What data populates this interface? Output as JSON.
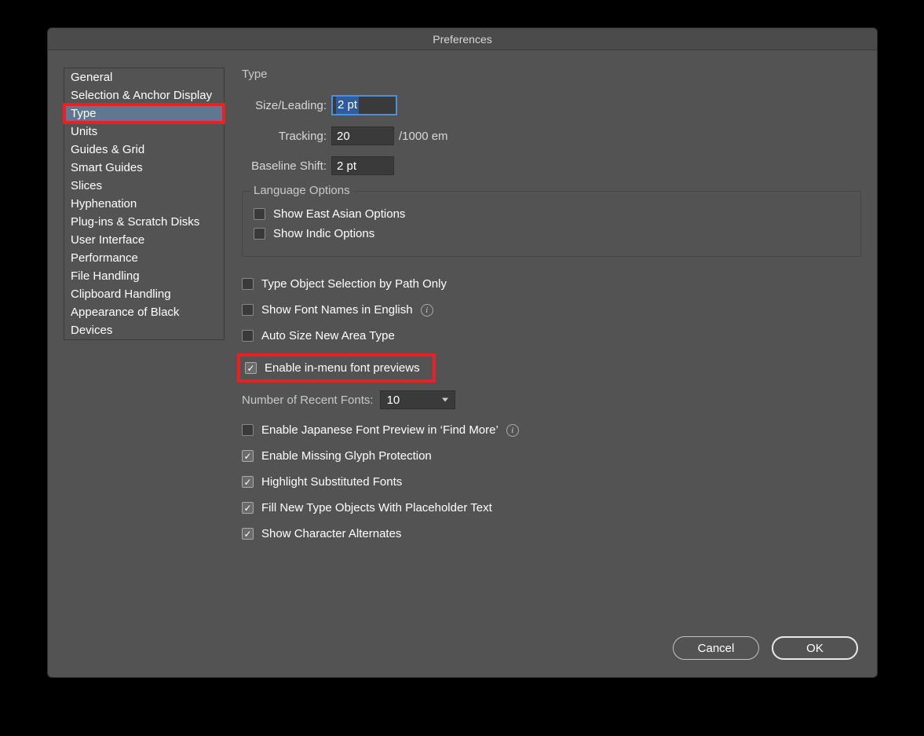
{
  "title": "Preferences",
  "sidebar": {
    "items": [
      "General",
      "Selection & Anchor Display",
      "Type",
      "Units",
      "Guides & Grid",
      "Smart Guides",
      "Slices",
      "Hyphenation",
      "Plug-ins & Scratch Disks",
      "User Interface",
      "Performance",
      "File Handling",
      "Clipboard Handling",
      "Appearance of Black",
      "Devices"
    ],
    "selectedIndex": 2
  },
  "panel": {
    "heading": "Type",
    "sizeLeading": {
      "label": "Size/Leading:",
      "value": "2 pt"
    },
    "tracking": {
      "label": "Tracking:",
      "value": "20",
      "unit": "/1000 em"
    },
    "baselineShift": {
      "label": "Baseline Shift:",
      "value": "2 pt"
    },
    "languageOptions": {
      "legend": "Language Options",
      "eastAsian": {
        "label": "Show East Asian Options",
        "checked": false
      },
      "indic": {
        "label": "Show Indic Options",
        "checked": false
      }
    },
    "typeObjectPath": {
      "label": "Type Object Selection by Path Only",
      "checked": false
    },
    "fontNamesEnglish": {
      "label": "Show Font Names in English",
      "checked": false
    },
    "autoSize": {
      "label": "Auto Size New Area Type",
      "checked": false
    },
    "inMenuPreview": {
      "label": "Enable in-menu font previews",
      "checked": true
    },
    "recentFonts": {
      "label": "Number of Recent Fonts:",
      "value": "10"
    },
    "jpPreview": {
      "label": "Enable Japanese Font Preview in ‘Find More’",
      "checked": false
    },
    "missingGlyph": {
      "label": "Enable Missing Glyph Protection",
      "checked": true
    },
    "highlightSub": {
      "label": "Highlight Substituted Fonts",
      "checked": true
    },
    "placeholder": {
      "label": "Fill New Type Objects With Placeholder Text",
      "checked": true
    },
    "charAlt": {
      "label": "Show Character Alternates",
      "checked": true
    }
  },
  "footer": {
    "cancel": "Cancel",
    "ok": "OK"
  }
}
